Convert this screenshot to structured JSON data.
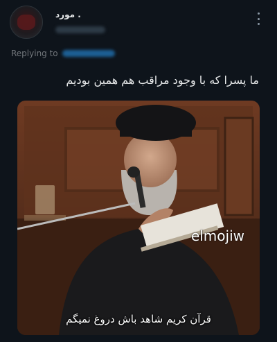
{
  "header": {
    "display_name": "مورد .",
    "more_icon": "more-vertical-icon"
  },
  "reply": {
    "label": "Replying to"
  },
  "tweet": {
    "text": "ما پسرا که با وجود مراقب هم همین بودیم"
  },
  "media": {
    "watermark": "elmojiw",
    "caption": "قرآن کریم شاهد باش دروغ نمیگم"
  },
  "colors": {
    "background": "#0e141b",
    "text": "#e7e9ea",
    "secondary": "#71767b"
  }
}
